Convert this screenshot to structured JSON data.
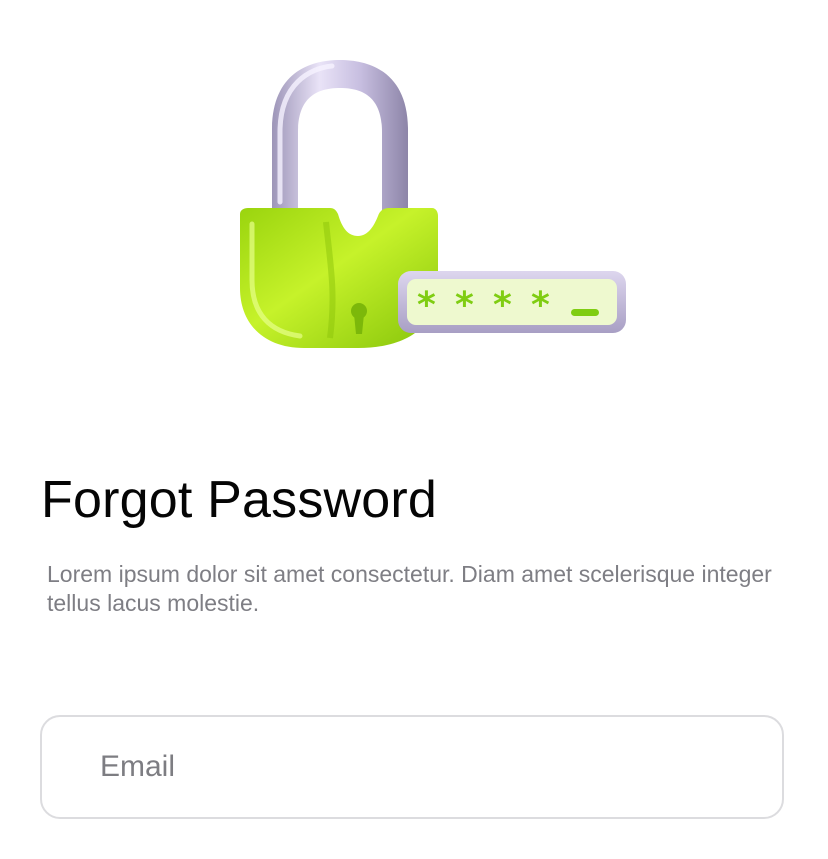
{
  "hero": {
    "illustration": "padlock-password-illustration",
    "password_mask": "****_",
    "colors": {
      "lock_body": "#b7ea1c",
      "shackle": "#c9bfe0",
      "field_fill": "#eef9cf",
      "mask": "#7fcd12"
    }
  },
  "screen": {
    "title": "Forgot Password",
    "description": "Lorem ipsum dolor sit amet consectetur. Diam amet scelerisque integer tellus lacus molestie."
  },
  "form": {
    "email": {
      "placeholder": "Email",
      "value": ""
    }
  }
}
